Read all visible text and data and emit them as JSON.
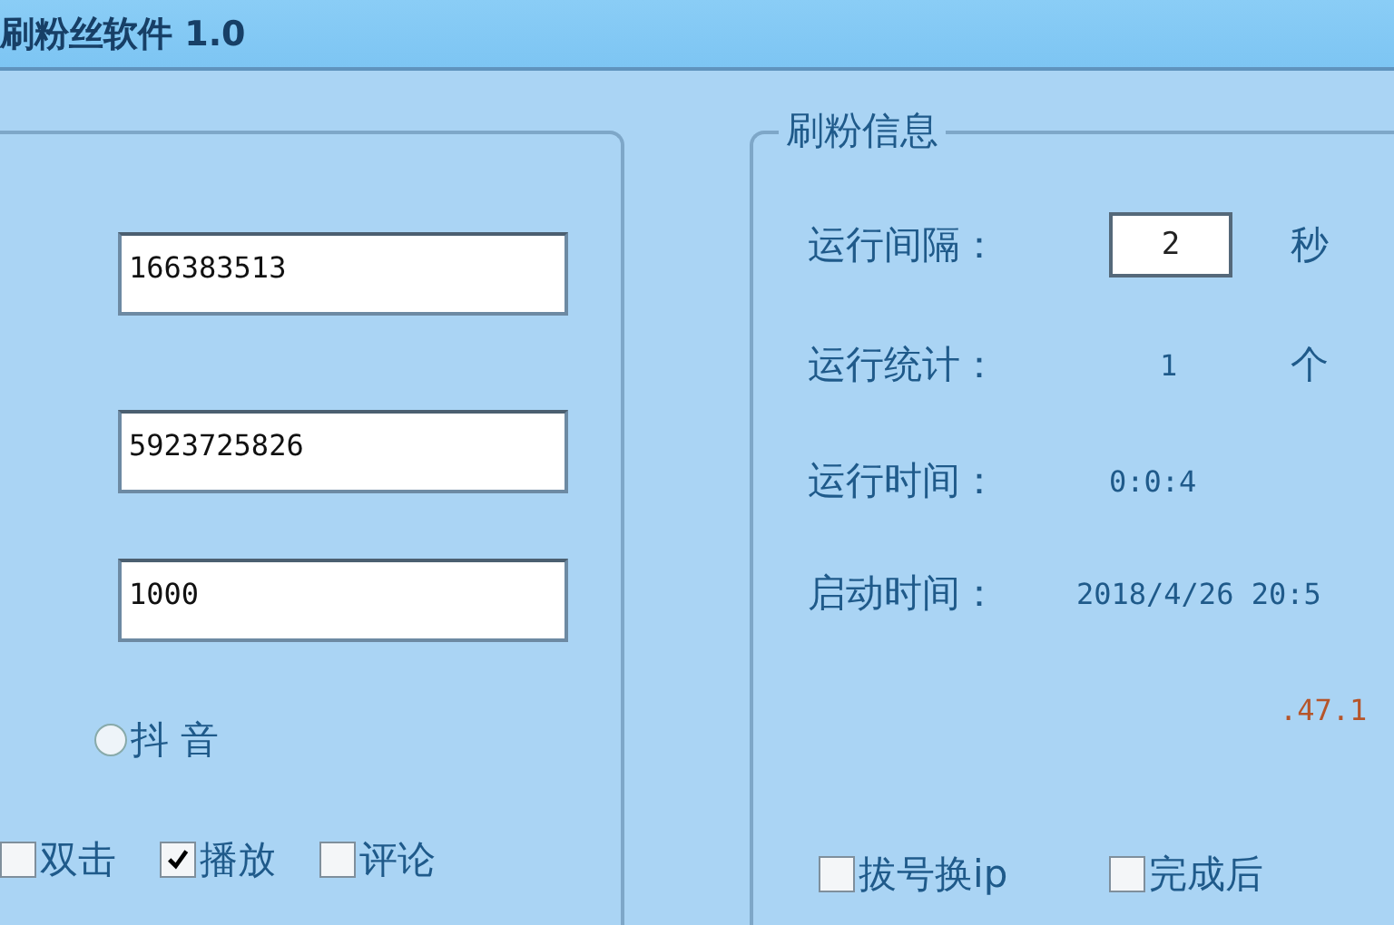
{
  "window": {
    "title": "刷粉丝软件 1.0"
  },
  "left_panel": {
    "fields": [
      {
        "value": "166383513"
      },
      {
        "value": "5923725826"
      },
      {
        "value": "1000"
      }
    ],
    "radios": [
      {
        "label": "抖 音",
        "selected": false
      }
    ],
    "checkboxes": [
      {
        "label": "双击",
        "checked": false
      },
      {
        "label": "播放",
        "checked": true
      },
      {
        "label": "评论",
        "checked": false
      }
    ]
  },
  "info_panel": {
    "title": "刷粉信息",
    "rows": [
      {
        "kind": "input",
        "label": "运行间隔：",
        "value": "2",
        "unit": "秒"
      },
      {
        "kind": "text",
        "label": "运行统计：",
        "value": "1",
        "unit": "个"
      },
      {
        "kind": "text",
        "label": "运行时间：",
        "value": "0:0:4"
      },
      {
        "kind": "text",
        "label": "启动时间：",
        "value": "2018/4/26 20:5"
      },
      {
        "kind": "partial",
        "value": ".47.1"
      }
    ],
    "checkboxes": [
      {
        "label": "拔号换ip",
        "checked": false
      },
      {
        "label": "完成后",
        "checked": false
      }
    ]
  }
}
